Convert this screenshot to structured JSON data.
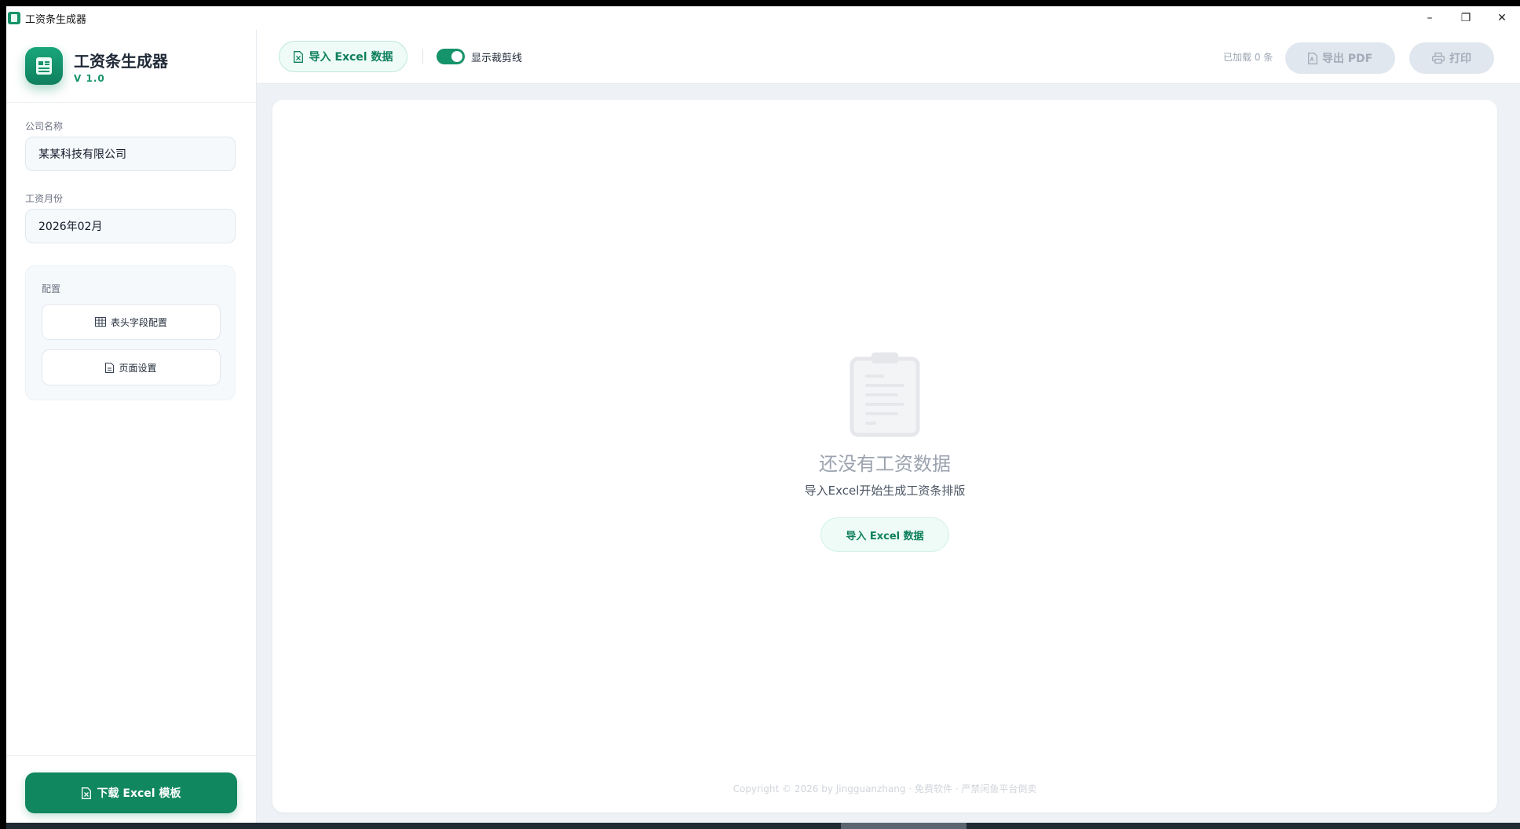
{
  "window": {
    "title": "工资条生成器",
    "controls": [
      "–",
      "❐",
      "✕"
    ]
  },
  "brand": {
    "name": "工资条生成器",
    "version": "V 1.0"
  },
  "sidebar": {
    "company_label": "公司名称",
    "company_value": "某某科技有限公司",
    "month_label": "工资月份",
    "month_value": "2026年02月",
    "config_title": "配置",
    "header_config_btn": "表头字段配置",
    "page_settings_btn": "页面设置",
    "download_btn": "下载 Excel 模板"
  },
  "toolbar": {
    "import_btn": "导入 Excel 数据",
    "toggle_label": "显示裁剪线",
    "toggle_on": true,
    "loaded_text": "已加载 0 条",
    "export_btn": "导出 PDF",
    "print_btn": "打印"
  },
  "empty_state": {
    "title": "还没有工资数据",
    "subtitle": "导入Excel开始生成工资条排版",
    "button": "导入 Excel 数据"
  },
  "footer": "Copyright © 2026 by Jingguanzhang · 免费软件 · 严禁闲鱼平台倒卖",
  "colors": {
    "accent": "#15936a",
    "accent_dark": "#11875f",
    "disabled": "#e1e7ee"
  },
  "icons": {
    "app": "payslip-app-icon",
    "excel": "excel-file-icon",
    "table": "table-icon",
    "page": "document-icon",
    "pdf": "pdf-file-icon",
    "print": "printer-icon",
    "empty": "clipboard-icon"
  }
}
